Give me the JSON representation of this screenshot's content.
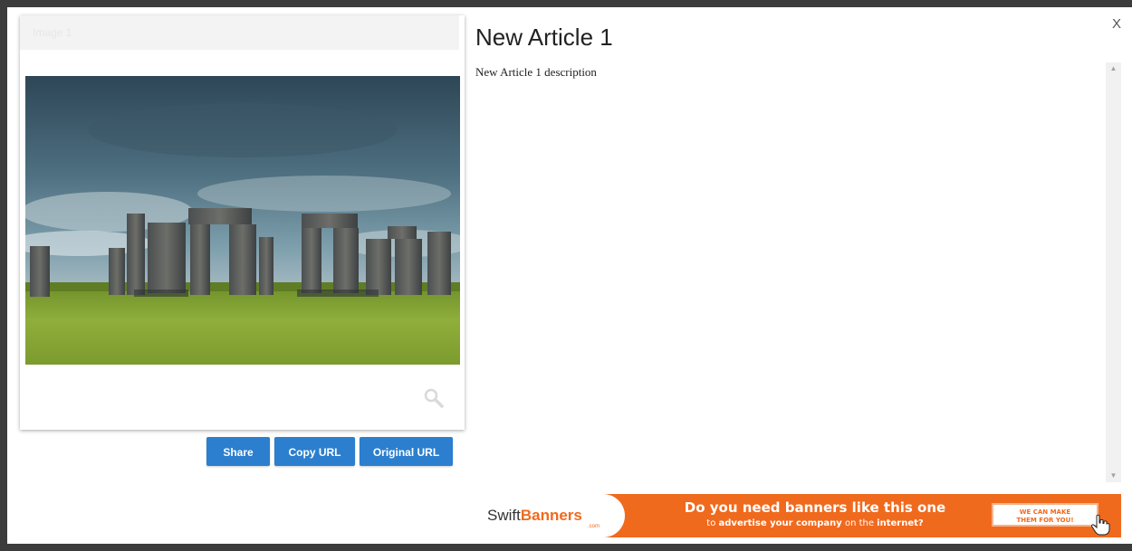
{
  "modal": {
    "close_label": "X"
  },
  "card": {
    "header_label": "Image 1",
    "photo_alt": "Stonehenge",
    "zoom_icon": "magnifier-icon"
  },
  "buttons": {
    "share": "Share",
    "copy_url": "Copy URL",
    "original_url": "Original URL"
  },
  "article": {
    "title": "New Article 1",
    "description": "New Article 1 description"
  },
  "banner": {
    "logo_swift": "Swift",
    "logo_banners": "Banners",
    "logo_com": ".com",
    "line1": "Do you need banners like this one",
    "line2_part1": "to ",
    "line2_part2": "advertise your company",
    "line2_part3": " on the ",
    "line2_part4": "internet?",
    "cta_line1": "WE CAN MAKE",
    "cta_line2": "THEM FOR YOU!"
  },
  "colors": {
    "button_blue": "#2b7fce",
    "banner_orange": "#f06a1e",
    "backdrop": "#3c3c3c"
  }
}
